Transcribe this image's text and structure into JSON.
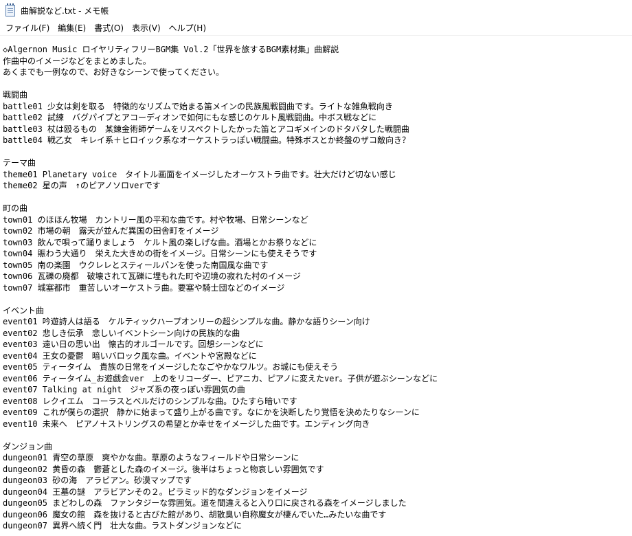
{
  "window": {
    "title": "曲解説など.txt - メモ帳"
  },
  "menu": [
    {
      "label": "ファイル(F)"
    },
    {
      "label": "編集(E)"
    },
    {
      "label": "書式(O)"
    },
    {
      "label": "表示(V)"
    },
    {
      "label": "ヘルプ(H)"
    }
  ],
  "document": {
    "text": "◇Algernon Music ロイヤリティフリーBGM集 Vol.2「世界を旅するBGM素材集」曲解説\n作曲中のイメージなどをまとめました。\nあくまでも一例なので、お好きなシーンで使ってください。\n\n戦闘曲\nbattle01 少女は剣を取る　特徴的なリズムで始まる笛メインの民族風戦闘曲です。ライトな雑魚戦向き\nbattle02 試練　バグパイプとアコーディオンで如何にもな感じのケルト風戦闘曲。中ボス戦などに\nbattle03 杖は殴るもの　某錬金術師ゲームをリスペクトしたかった笛とアコギメインのドタバタした戦闘曲\nbattle04 戦乙女　キレイ系＋ヒロイック系なオーケストラっぽい戦闘曲。特殊ボスとか終盤のザコ敵向き？\n\nテーマ曲\ntheme01 Planetary voice　タイトル画面をイメージしたオーケストラ曲です。壮大だけど切ない感じ\ntheme02 星の声　↑のピアノソロverです\n\n町の曲\ntown01 のほほん牧場　カントリー風の平和な曲です。村や牧場、日常シーンなど\ntown02 市場の朝　露天が並んだ異国の田舎町をイメージ\ntown03 飲んで唄って踊りましょう　ケルト風の楽しげな曲。酒場とかお祭りなどに\ntown04 賑わう大通り　栄えた大きめの街をイメージ。日常シーンにも使えそうです\ntown05 南の楽園　ウクレレとスティールパンを使った南国風な曲です\ntown06 瓦礫の廃都　破壊されて瓦礫に埋もれた町や辺境の寂れた村のイメージ\ntown07 城塞都市　重苦しいオーケストラ曲。要塞や騎士団などのイメージ\n\nイベント曲\nevent01 吟遊詩人は語る　ケルティックハープオンリーの超シンプルな曲。静かな語りシーン向け\nevent02 悲しき伝承　悲しいイベントシーン向けの民族的な曲\nevent03 遠い日の思い出　懐古的オルゴールです。回想シーンなどに\nevent04 王女の憂鬱　暗いバロック風な曲。イベントや宮殿などに\nevent05 ティータイム　貴族の日常をイメージしたなごやかなワルツ。お城にも使えそう\nevent06 ティータイム_お遊戯会ver　上のをリコーダー、ピアニカ、ピアノに変えたver。子供が遊ぶシーンなどに\nevent07 Talking at night　ジャズ系の夜っぽい雰囲気の曲\nevent08 レクイエム　コーラスとベルだけのシンプルな曲。ひたすら暗いです\nevent09 これが僕らの選択　静かに始まって盛り上がる曲です。なにかを決断したり覚悟を決めたりなシーンに\nevent10 未来へ　ピアノ＋ストリングスの希望とか幸せをイメージした曲です。エンディング向き\n\nダンジョン曲\ndungeon01 青空の草原　爽やかな曲。草原のようなフィールドや日常シーンに\ndungeon02 黄昏の森　鬱蒼とした森のイメージ。後半はちょっと物哀しい雰囲気です\ndungeon03 砂の海　アラビアン。砂漠マップです\ndungeon04 王墓の謎　アラビアンその２。ピラミッド的なダンジョンをイメージ\ndungeon05 まどわしの森　ファンタジーな雰囲気。道を間違えると入り口に戻される森をイメージしました\ndungeon06 魔女の館　森を抜けると古びた館があり、胡散臭い自称魔女が棲んでいた…みたいな曲です\ndungeon07 異界へ続く門　壮大な曲。ラストダンジョンなどに"
  }
}
